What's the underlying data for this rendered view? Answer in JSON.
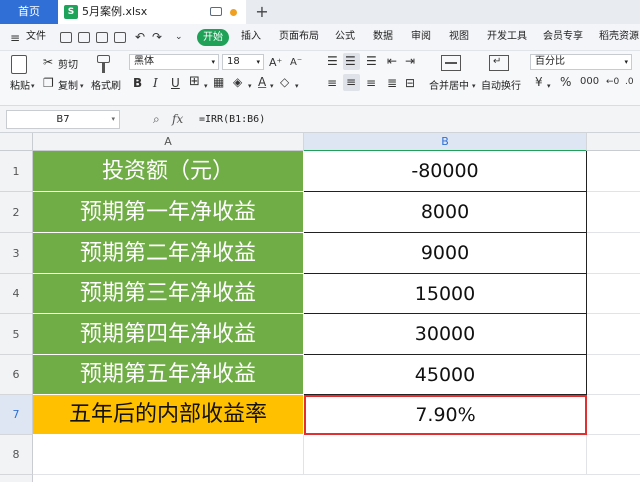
{
  "titlebar": {
    "home_label": "首页",
    "file_name": "5月案例.xlsx",
    "file_icon_label": "S",
    "new_tab_label": "+"
  },
  "menu": {
    "file_label": "文件",
    "items": [
      "开始",
      "插入",
      "页面布局",
      "公式",
      "数据",
      "审阅",
      "视图",
      "开发工具",
      "会员专享",
      "稻壳资源"
    ],
    "active": "开始",
    "active_color": "#1fa158"
  },
  "ribbon": {
    "paste_label": "粘贴",
    "cut_label": "剪切",
    "copy_label": "复制",
    "format_painter_label": "格式刷",
    "font_name": "黑体",
    "font_size": "18",
    "bold": "B",
    "italic": "I",
    "underline": "U",
    "merge_label": "合并居中",
    "wrap_label": "自动换行",
    "number_format": "百分比",
    "currency_symbol": "¥",
    "percent_symbol": "%"
  },
  "formula_bar": {
    "name_box": "B7",
    "fx_label": "fx",
    "formula": "=IRR(B1:B6)"
  },
  "sheet": {
    "columns": [
      "A",
      "B"
    ],
    "rows": [
      {
        "num": "1",
        "label": "投资额（元）",
        "value": "-80000"
      },
      {
        "num": "2",
        "label": "预期第一年净收益",
        "value": "8000"
      },
      {
        "num": "3",
        "label": "预期第二年净收益",
        "value": "9000"
      },
      {
        "num": "4",
        "label": "预期第三年净收益",
        "value": "15000"
      },
      {
        "num": "5",
        "label": "预期第四年净收益",
        "value": "30000"
      },
      {
        "num": "6",
        "label": "预期第五年净收益",
        "value": "45000"
      },
      {
        "num": "7",
        "label": "五年后的内部收益率",
        "value": "7.90%"
      },
      {
        "num": "8",
        "label": "",
        "value": ""
      }
    ],
    "colors": {
      "label_fill": "#70ad47",
      "result_label_fill": "#ffc000",
      "selection_border": "#e03030",
      "selected_header_fill": "#dde6f2"
    }
  }
}
